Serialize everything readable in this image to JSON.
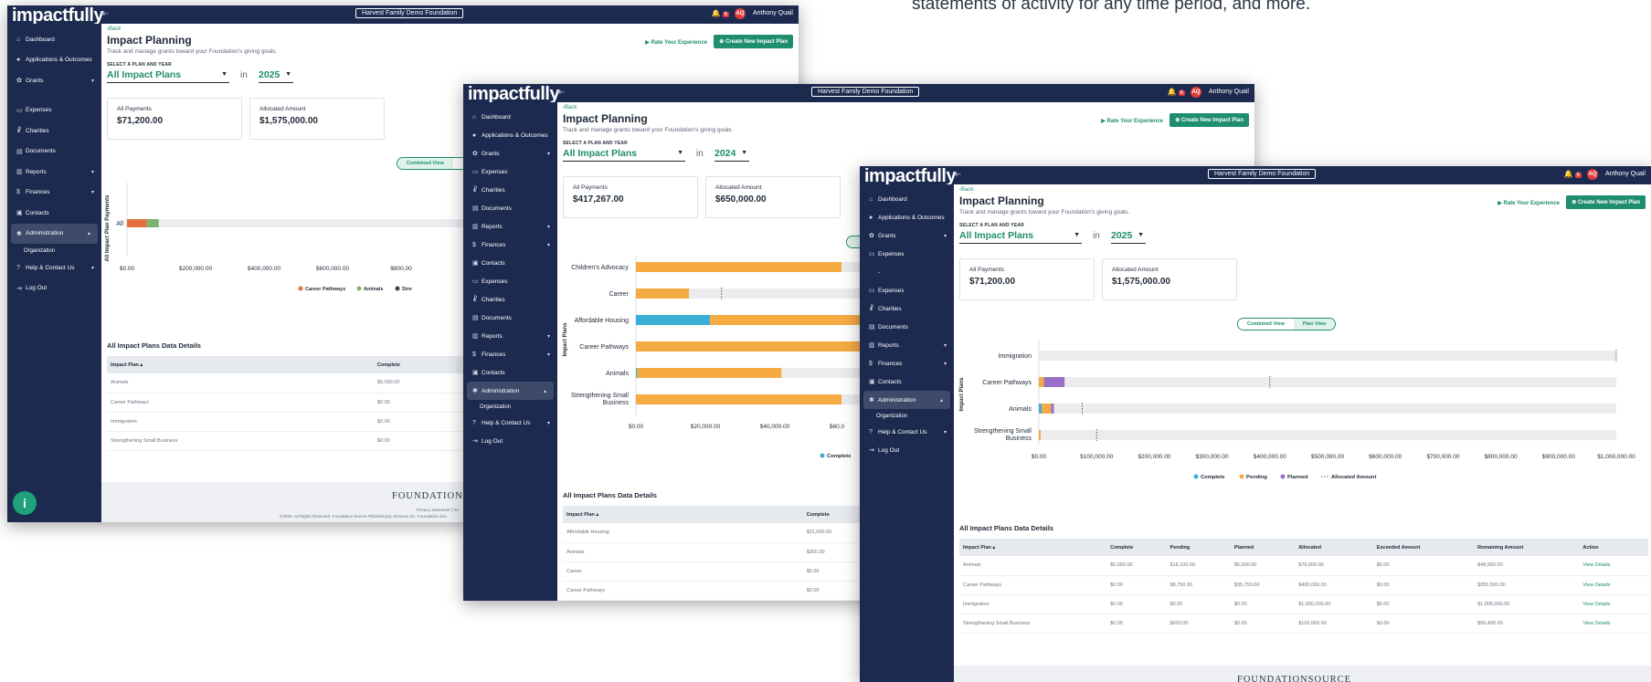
{
  "caption": "statements of activity for any time period, and more.",
  "app": {
    "logo": "impactfully",
    "logo_sub": "FOUNDATIONSOURCE",
    "org": "Harvest Family Demo Foundation",
    "notif_count": "6",
    "user_initials": "AQ",
    "user_name": "Anthony Quail"
  },
  "sidebar": {
    "items": [
      {
        "label": "Dashboard",
        "icon": "home-icon"
      },
      {
        "label": "Applications & Outcomes",
        "icon": "chat-icon"
      },
      {
        "label": "Grants",
        "icon": "gear-icon"
      },
      {
        "label": "Expenses",
        "icon": "receipt-icon"
      },
      {
        "label": "Charities",
        "icon": "people-icon"
      },
      {
        "label": "Documents",
        "icon": "document-icon"
      },
      {
        "label": "Reports",
        "icon": "chart-icon"
      },
      {
        "label": "Finances",
        "icon": "dollar-icon"
      },
      {
        "label": "Contacts",
        "icon": "contacts-icon"
      },
      {
        "label": "Administration",
        "icon": "settings-icon"
      },
      {
        "label": "Organization",
        "icon": ""
      },
      {
        "label": "Help & Contact Us",
        "icon": "help-icon"
      },
      {
        "label": "Log Out",
        "icon": "logout-icon"
      }
    ],
    "items2": [
      {
        "label": "Dashboard"
      },
      {
        "label": "Applications & Outcomes"
      },
      {
        "label": "Grants"
      },
      {
        "label": "Expenses"
      },
      {
        "label": "Charities"
      },
      {
        "label": "Documents"
      },
      {
        "label": "Reports"
      },
      {
        "label": "Finances"
      },
      {
        "label": "Contacts"
      },
      {
        "label": "Expenses"
      },
      {
        "label": "Charities"
      },
      {
        "label": "Documents"
      },
      {
        "label": "Reports"
      },
      {
        "label": "Finances"
      },
      {
        "label": "Contacts"
      },
      {
        "label": "Administration"
      },
      {
        "label": "Organization"
      },
      {
        "label": "Help & Contact Us"
      },
      {
        "label": "Log Out"
      }
    ],
    "items3": [
      {
        "label": "Dashboard"
      },
      {
        "label": "Applications & Outcomes"
      },
      {
        "label": "Grants"
      },
      {
        "label": "Expenses"
      },
      {
        "label": "-"
      },
      {
        "label": "Expenses"
      },
      {
        "label": "Charities"
      },
      {
        "label": "Documents"
      },
      {
        "label": "Reports"
      },
      {
        "label": "Finances"
      },
      {
        "label": "Contacts"
      },
      {
        "label": "Administration"
      },
      {
        "label": "Organization"
      },
      {
        "label": "Help & Contact Us"
      },
      {
        "label": "Log Out"
      }
    ]
  },
  "page": {
    "back": "Back",
    "title": "Impact Planning",
    "subtitle": "Track and manage grants toward your Foundation's giving goals.",
    "rate": "Rate Your Experience",
    "create": "Create New Impact Plan",
    "select_label": "SELECT A PLAN AND YEAR",
    "plan": "All Impact Plans",
    "in": "in",
    "toggle_combined": "Combined View",
    "toggle_plan": "Plan View",
    "table_title": "All Impact Plans Data Details"
  },
  "windows": [
    {
      "year": "2025",
      "all_payments_label": "All Payments",
      "all_payments": "$71,200.00",
      "allocated_label": "Allocated Amount",
      "allocated": "$1,575,000.00"
    },
    {
      "year": "2024",
      "all_payments_label": "All Payments",
      "all_payments": "$417,267.00",
      "allocated_label": "Allocated Amount",
      "allocated": "$650,000.00"
    },
    {
      "year": "2025",
      "all_payments_label": "All Payments",
      "all_payments": "$71,200.00",
      "allocated_label": "Allocated Amount",
      "allocated": "$1,575,000.00"
    }
  ],
  "table1": {
    "headers": [
      "Impact Plan ▴",
      "Complete",
      "Pending",
      "Planned",
      "Allocat"
    ],
    "rows": [
      [
        "Animals",
        "$5,000.00",
        "$16,100.00",
        "$5,000.00",
        "$75"
      ],
      [
        "Career Pathways",
        "$0.00",
        "$8,750.00",
        "$35,750.00",
        "$40"
      ],
      [
        "Immigration",
        "$0.00",
        "$0.00",
        "$0.00",
        "$1,0"
      ],
      [
        "Strengthening Small Business",
        "$0.00",
        "$600.00",
        "$0.00",
        "$10"
      ]
    ]
  },
  "table2": {
    "headers": [
      "Impact Plan ▴",
      "Complete",
      "Pending",
      "Planned"
    ],
    "rows": [
      [
        "Affordable Housing",
        "$21,600.00",
        "$53,750.00",
        "$0.00"
      ],
      [
        "Animals",
        "$350.00",
        "$42,115.00",
        "$0.00"
      ],
      [
        "Career",
        "$0.00",
        "$15,500.00",
        "$0.00"
      ],
      [
        "Career Pathways",
        "$0.00",
        "$137,904.00",
        "$0.00"
      ]
    ]
  },
  "table3": {
    "headers": [
      "Impact Plan ▴",
      "Complete",
      "Pending",
      "Planned",
      "Allocated",
      "Exceeded Amount",
      "Remaining Amount",
      "Action"
    ],
    "rows": [
      [
        "Animals",
        "$5,000.00",
        "$16,100.00",
        "$5,000.00",
        "$75,000.00",
        "$0.00",
        "$48,900.00",
        "View Details"
      ],
      [
        "Career Pathways",
        "$0.00",
        "$8,750.00",
        "$35,750.00",
        "$400,000.00",
        "$0.00",
        "$355,500.00",
        "View Details"
      ],
      [
        "Immigration",
        "$0.00",
        "$0.00",
        "$0.00",
        "$1,000,000.00",
        "$0.00",
        "$1,000,000.00",
        "View Details"
      ],
      [
        "Strengthening Small Business",
        "$0.00",
        "$600.00",
        "$0.00",
        "$100,000.00",
        "$0.00",
        "$99,400.00",
        "View Details"
      ]
    ]
  },
  "footer": {
    "brand": "FOUNDATIONSOURCE",
    "brand_cut": "FOUNDATION",
    "privacy": "Privacy Statement  |  Ter",
    "copyright": "©2025. All Rights Reserved. Foundation Source Philanthropic Services Inc. Foundation Sou"
  },
  "colors": {
    "navy": "#1c2a4f",
    "green": "#1e8e6e",
    "complete": "#3bb0d6",
    "pending": "#f5aa42",
    "planned": "#9b6fc9",
    "career_pathways": "#e4703d",
    "animals": "#7fb26a",
    "track": "#ececef"
  },
  "chart_data": [
    {
      "type": "bar",
      "orientation": "horizontal",
      "ylabel": "All Impact Plan Payments",
      "categories": [
        "All"
      ],
      "series": [
        {
          "name": "Career Pathways",
          "values": [
            44500
          ]
        },
        {
          "name": "Animals",
          "values": [
            26700
          ]
        }
      ],
      "xticks": [
        "$0.00",
        "$200,000.00",
        "$400,000.00",
        "$600,000.00",
        "$800,00"
      ],
      "xlim": [
        0,
        1575000
      ],
      "legend": [
        "Career Pathways",
        "Animals",
        "Stre"
      ],
      "legend_position": "bottom"
    },
    {
      "type": "bar",
      "orientation": "horizontal",
      "ylabel": "Impact Plans",
      "categories": [
        "Children's Advocacy",
        "Career",
        "Affordable Housing",
        "Career Pathways",
        "Animals",
        "Strengthening Small Business"
      ],
      "series": [
        {
          "name": "Complete",
          "values": [
            0,
            0,
            21600,
            0,
            350,
            0
          ]
        },
        {
          "name": "Pending",
          "values": [
            60000,
            15500,
            53750,
            137904,
            42115,
            60000
          ]
        }
      ],
      "allocated_marks": [
        null,
        25000,
        null,
        null,
        null,
        null
      ],
      "xticks": [
        "$0.00",
        "$20,000.00",
        "$40,000.00",
        "$60,0"
      ],
      "xlim": [
        0,
        60000
      ],
      "legend": [
        "Complete"
      ],
      "legend_position": "bottom"
    },
    {
      "type": "bar",
      "orientation": "horizontal",
      "ylabel": "Impact Plans",
      "categories": [
        "Immigration",
        "Career Pathways",
        "Animals",
        "Strengthening Small Business"
      ],
      "series": [
        {
          "name": "Complete",
          "values": [
            0,
            0,
            5000,
            0
          ]
        },
        {
          "name": "Pending",
          "values": [
            0,
            8750,
            16100,
            600
          ]
        },
        {
          "name": "Planned",
          "values": [
            0,
            35750,
            5000,
            0
          ]
        }
      ],
      "allocated": [
        1000000,
        400000,
        75000,
        100000
      ],
      "xticks": [
        "$0.00",
        "$100,000.00",
        "$200,000.00",
        "$300,000.00",
        "$400,000.00",
        "$500,000.00",
        "$600,000.00",
        "$700,000.00",
        "$800,000.00",
        "$900,000.00",
        "$1,000,000.00"
      ],
      "xlim": [
        0,
        1000000
      ],
      "legend": [
        "Complete",
        "Pending",
        "Planned",
        "Allocated Amount"
      ],
      "legend_position": "bottom"
    }
  ]
}
